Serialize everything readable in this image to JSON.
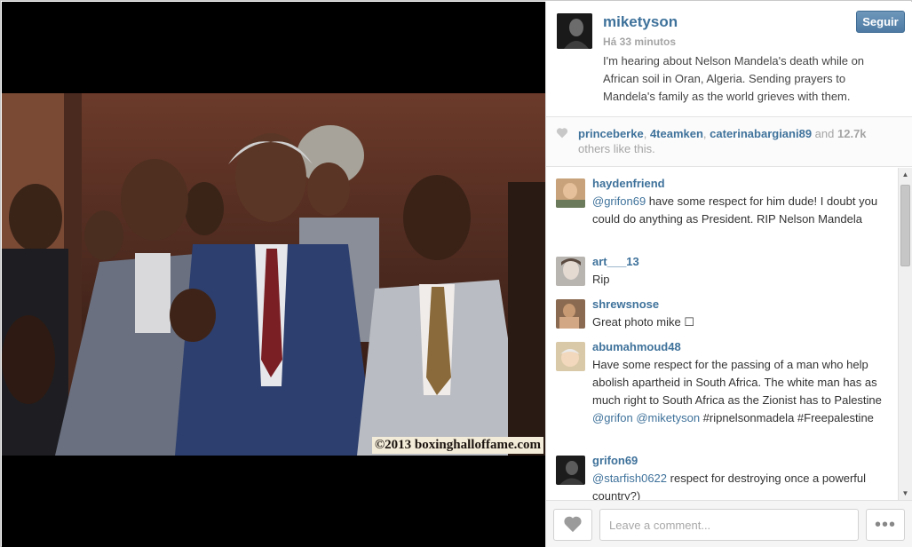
{
  "post": {
    "username": "miketyson",
    "follow_label": "Seguir",
    "timestamp": "Há 33 minutos",
    "caption": "I'm hearing about Nelson Mandela's death while on African soil in Oran, Algeria. Sending prayers to Mandela's family as the world grieves with them.",
    "photo_watermark": "©2013 boxinghalloffame.com"
  },
  "likes": {
    "users": [
      "princeberke",
      "4teamken",
      "caterinabargiani89"
    ],
    "and_text": "and",
    "count": "12.7k",
    "suffix": "others like this."
  },
  "comments": [
    {
      "user": "haydenfriend",
      "mention": "@grifon69",
      "text": " have some respect for him dude! I doubt you could do anything as President. RIP Nelson Mandela"
    },
    {
      "user": "art___13",
      "text": "Rip"
    },
    {
      "user": "shrewsnose",
      "text": "Great photo mike ☐"
    },
    {
      "user": "abumahmoud48",
      "text": "Have some respect for the passing of a man who help abolish apartheid in South Africa. The white man has as much right to South Africa as the Zionist has to Palestine ",
      "mention1": "@grifon",
      "mention2": "@miketyson",
      "tail": " #ripnelsonmadela #Freepalestine"
    },
    {
      "user": "grifon69",
      "mention": "@starfish0622",
      "text": " respect for destroying once a powerful country?)"
    }
  ],
  "footer": {
    "comment_placeholder": "Leave a comment...",
    "more_label": "•••"
  },
  "icons": {
    "like": "heart-icon",
    "more": "ellipsis-icon",
    "scroll_up": "triangle-up-icon",
    "scroll_down": "triangle-down-icon"
  },
  "colors": {
    "link": "#3f729b",
    "follow_button": "#517fa4",
    "muted": "#a5a5a5"
  }
}
